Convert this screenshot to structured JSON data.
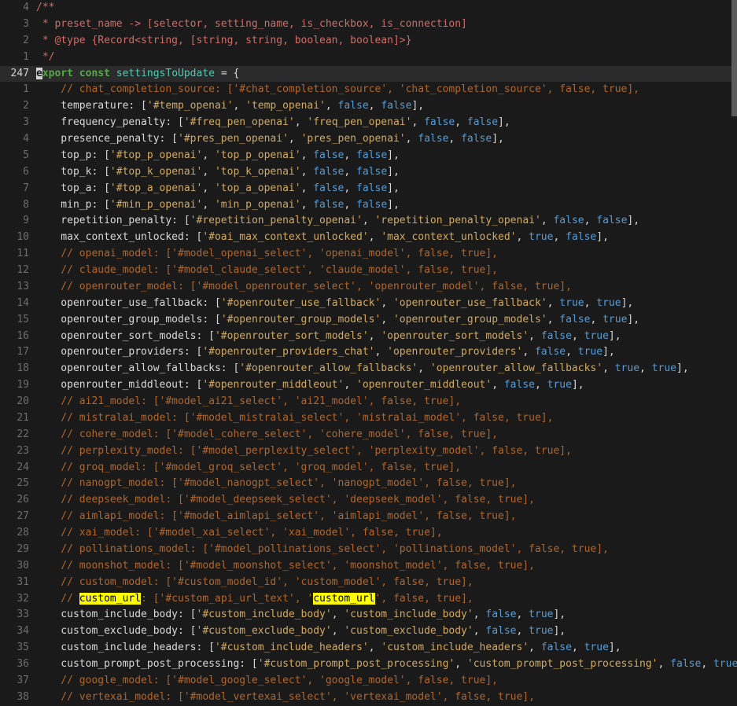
{
  "editor": {
    "search_term": "custom_url",
    "colors": {
      "bg": "#1a1a1a",
      "curbg": "#2b2b2b",
      "num": "#6d6d6d",
      "curnum": "#d0d0d0",
      "pl": "#d8d8d8",
      "cm": "#cd6d68",
      "lc": "#b0662a",
      "kw": "#57a64a",
      "ty": "#4ec9b0",
      "st": "#d1aa60",
      "bo": "#569cd6",
      "hlbg": "#ffff00",
      "hlfg": "#000000",
      "cursorbg": "#d4d4d4",
      "cursorfg": "#1a1a1a",
      "sb": "#5c5c5c"
    },
    "lines": [
      {
        "num": "4",
        "kind": "comment_block",
        "text": "/**"
      },
      {
        "num": "3",
        "kind": "comment_block",
        "text": " * preset_name -> [selector, setting_name, is_checkbox, is_connection]"
      },
      {
        "num": "2",
        "kind": "comment_block",
        "text": " * @type {Record<string, [string, string, boolean, boolean]>}"
      },
      {
        "num": "1",
        "kind": "comment_block",
        "text": " */"
      },
      {
        "num": "247",
        "kind": "code",
        "current": true,
        "cursor_col": 0,
        "text": "export const settingsToUpdate = {"
      },
      {
        "num": "1",
        "kind": "comment_line",
        "text": "    // chat_completion_source: ['#chat_completion_source', 'chat_completion_source', false, true],"
      },
      {
        "num": "2",
        "kind": "code",
        "text": "    temperature: ['#temp_openai', 'temp_openai', false, false],"
      },
      {
        "num": "3",
        "kind": "code",
        "text": "    frequency_penalty: ['#freq_pen_openai', 'freq_pen_openai', false, false],"
      },
      {
        "num": "4",
        "kind": "code",
        "text": "    presence_penalty: ['#pres_pen_openai', 'pres_pen_openai', false, false],"
      },
      {
        "num": "5",
        "kind": "code",
        "text": "    top_p: ['#top_p_openai', 'top_p_openai', false, false],"
      },
      {
        "num": "6",
        "kind": "code",
        "text": "    top_k: ['#top_k_openai', 'top_k_openai', false, false],"
      },
      {
        "num": "7",
        "kind": "code",
        "text": "    top_a: ['#top_a_openai', 'top_a_openai', false, false],"
      },
      {
        "num": "8",
        "kind": "code",
        "text": "    min_p: ['#min_p_openai', 'min_p_openai', false, false],"
      },
      {
        "num": "9",
        "kind": "code",
        "text": "    repetition_penalty: ['#repetition_penalty_openai', 'repetition_penalty_openai', false, false],"
      },
      {
        "num": "10",
        "kind": "code",
        "text": "    max_context_unlocked: ['#oai_max_context_unlocked', 'max_context_unlocked', true, false],"
      },
      {
        "num": "11",
        "kind": "comment_line",
        "text": "    // openai_model: ['#model_openai_select', 'openai_model', false, true],"
      },
      {
        "num": "12",
        "kind": "comment_line",
        "text": "    // claude_model: ['#model_claude_select', 'claude_model', false, true],"
      },
      {
        "num": "13",
        "kind": "comment_line",
        "text": "    // openrouter_model: ['#model_openrouter_select', 'openrouter_model', false, true],"
      },
      {
        "num": "14",
        "kind": "code",
        "text": "    openrouter_use_fallback: ['#openrouter_use_fallback', 'openrouter_use_fallback', true, true],"
      },
      {
        "num": "15",
        "kind": "code",
        "text": "    openrouter_group_models: ['#openrouter_group_models', 'openrouter_group_models', false, true],"
      },
      {
        "num": "16",
        "kind": "code",
        "text": "    openrouter_sort_models: ['#openrouter_sort_models', 'openrouter_sort_models', false, true],"
      },
      {
        "num": "17",
        "kind": "code",
        "text": "    openrouter_providers: ['#openrouter_providers_chat', 'openrouter_providers', false, true],"
      },
      {
        "num": "18",
        "kind": "code",
        "text": "    openrouter_allow_fallbacks: ['#openrouter_allow_fallbacks', 'openrouter_allow_fallbacks', true, true],"
      },
      {
        "num": "19",
        "kind": "code",
        "text": "    openrouter_middleout: ['#openrouter_middleout', 'openrouter_middleout', false, true],"
      },
      {
        "num": "20",
        "kind": "comment_line",
        "text": "    // ai21_model: ['#model_ai21_select', 'ai21_model', false, true],"
      },
      {
        "num": "21",
        "kind": "comment_line",
        "text": "    // mistralai_model: ['#model_mistralai_select', 'mistralai_model', false, true],"
      },
      {
        "num": "22",
        "kind": "comment_line",
        "text": "    // cohere_model: ['#model_cohere_select', 'cohere_model', false, true],"
      },
      {
        "num": "23",
        "kind": "comment_line",
        "text": "    // perplexity_model: ['#model_perplexity_select', 'perplexity_model', false, true],"
      },
      {
        "num": "24",
        "kind": "comment_line",
        "text": "    // groq_model: ['#model_groq_select', 'groq_model', false, true],"
      },
      {
        "num": "25",
        "kind": "comment_line",
        "text": "    // nanogpt_model: ['#model_nanogpt_select', 'nanogpt_model', false, true],"
      },
      {
        "num": "26",
        "kind": "comment_line",
        "text": "    // deepseek_model: ['#model_deepseek_select', 'deepseek_model', false, true],"
      },
      {
        "num": "27",
        "kind": "comment_line",
        "text": "    // aimlapi_model: ['#model_aimlapi_select', 'aimlapi_model', false, true],"
      },
      {
        "num": "28",
        "kind": "comment_line",
        "text": "    // xai_model: ['#model_xai_select', 'xai_model', false, true],"
      },
      {
        "num": "29",
        "kind": "comment_line",
        "text": "    // pollinations_model: ['#model_pollinations_select', 'pollinations_model', false, true],"
      },
      {
        "num": "30",
        "kind": "comment_line",
        "text": "    // moonshot_model: ['#model_moonshot_select', 'moonshot_model', false, true],"
      },
      {
        "num": "31",
        "kind": "comment_line",
        "text": "    // custom_model: ['#custom_model_id', 'custom_model', false, true],"
      },
      {
        "num": "32",
        "kind": "comment_line",
        "search": true,
        "text": "    // custom_url: ['#custom_api_url_text', 'custom_url', false, true],"
      },
      {
        "num": "33",
        "kind": "code",
        "text": "    custom_include_body: ['#custom_include_body', 'custom_include_body', false, true],"
      },
      {
        "num": "34",
        "kind": "code",
        "text": "    custom_exclude_body: ['#custom_exclude_body', 'custom_exclude_body', false, true],"
      },
      {
        "num": "35",
        "kind": "code",
        "text": "    custom_include_headers: ['#custom_include_headers', 'custom_include_headers', false, true],"
      },
      {
        "num": "36",
        "kind": "code",
        "text": "    custom_prompt_post_processing: ['#custom_prompt_post_processing', 'custom_prompt_post_processing', false, true],"
      },
      {
        "num": "37",
        "kind": "comment_line",
        "text": "    // google_model: ['#model_google_select', 'google_model', false, true],"
      },
      {
        "num": "38",
        "kind": "comment_line",
        "text": "    // vertexai_model: ['#model_vertexai_select', 'vertexai_model', false, true],"
      }
    ]
  }
}
